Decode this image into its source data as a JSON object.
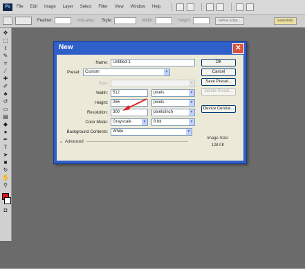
{
  "menubar": {
    "logo": "Ps",
    "items": [
      "File",
      "Edit",
      "Image",
      "Layer",
      "Select",
      "Filter",
      "View",
      "Window",
      "Help"
    ]
  },
  "optionsbar": {
    "feather_label": "Feather:",
    "feather_value": "0 px",
    "antialias_label": "Anti-alias",
    "style_label": "Style:",
    "style_value": "Normal",
    "width_label": "Width:",
    "height_label": "Height:",
    "refine_label": "Refine Edge...",
    "workspace_label": "Essentials"
  },
  "dialog": {
    "title": "New",
    "close_glyph": "✕",
    "name_label": "Name:",
    "name_value": "Untitled-1",
    "preset_label": "Preset:",
    "preset_value": "Custom",
    "size_label": "Size:",
    "size_value": "",
    "width_label": "Width:",
    "width_value": "512",
    "width_unit": "pixels",
    "height_label": "Height:",
    "height_value": "256",
    "height_unit": "pixels",
    "resolution_label": "Resolution:",
    "resolution_value": "300",
    "resolution_unit": "pixels/inch",
    "colormode_label": "Color Mode:",
    "colormode_value": "Grayscale",
    "colormode_bits": "8 bit",
    "background_label": "Background Contents:",
    "background_value": "White",
    "advanced_label": "Advanced",
    "buttons": {
      "ok": "OK",
      "cancel": "Cancel",
      "save_preset": "Save Preset...",
      "delete_preset": "Delete Preset...",
      "device_central": "Device Central..."
    },
    "image_size_label": "Image Size:",
    "image_size_value": "128.0K"
  },
  "annotation": {
    "arrow_color": "#e02020"
  }
}
